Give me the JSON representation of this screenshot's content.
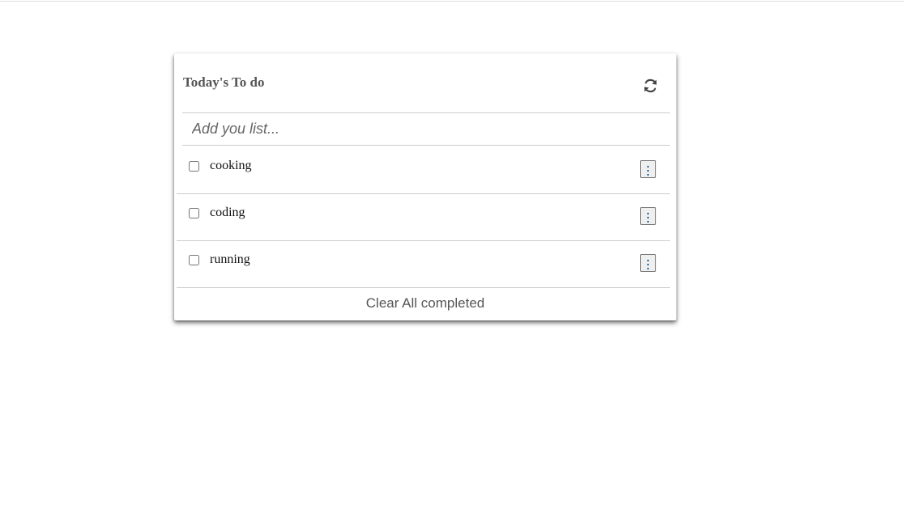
{
  "app": {
    "title": "Today's To do",
    "refresh_icon": "refresh-icon"
  },
  "input": {
    "placeholder": "Add you list...",
    "value": ""
  },
  "todos": [
    {
      "label": "cooking",
      "checked": false,
      "menu_icon": "kebab-menu-icon"
    },
    {
      "label": "coding",
      "checked": false,
      "menu_icon": "kebab-menu-icon"
    },
    {
      "label": "running",
      "checked": false,
      "menu_icon": "kebab-menu-icon"
    }
  ],
  "footer": {
    "clear_label": "Clear All completed"
  },
  "colors": {
    "title": "#555555",
    "divider": "#cccccc",
    "menu_button_bg": "#efefef",
    "menu_dots": "#2b6cb0"
  }
}
